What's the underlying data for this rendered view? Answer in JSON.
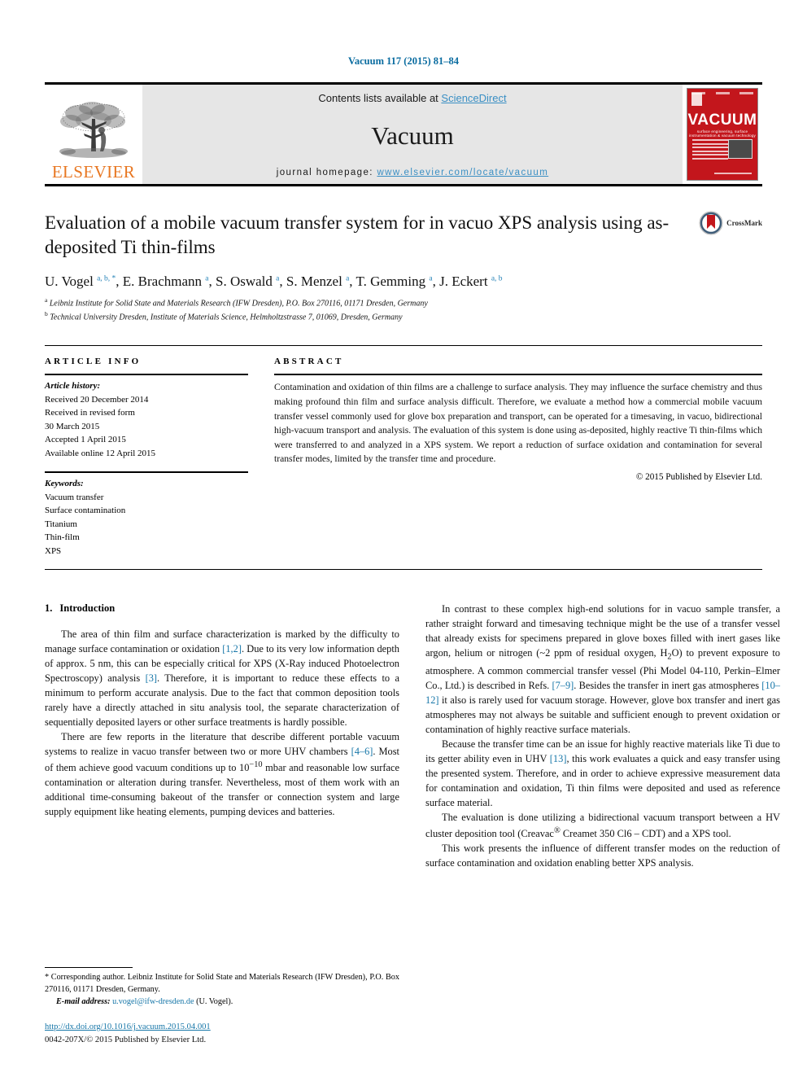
{
  "running_head": "Vacuum 117 (2015) 81–84",
  "masthead": {
    "publisher_name": "ELSEVIER",
    "contents_prefix": "Contents lists available at ",
    "contents_link": "ScienceDirect",
    "journal_name": "Vacuum",
    "homepage_prefix": "journal homepage: ",
    "homepage_url": "www.elsevier.com/locate/vacuum",
    "cover": {
      "title": "VACUUM",
      "subtitle": "surface engineering, surface instrumentation & vacuum technology"
    }
  },
  "article": {
    "title": "Evaluation of a mobile vacuum transfer system for in vacuo XPS analysis using as-deposited Ti thin-films",
    "crossmark_label": "CrossMark",
    "authors_html": "U. Vogel <sup>a, b, *</sup>, E. Brachmann <sup>a</sup>, S. Oswald <sup>a</sup>, S. Menzel <sup>a</sup>, T. Gemming <sup>a</sup>, J. Eckert <sup>a, b</sup>",
    "affiliations": [
      "Leibniz Institute for Solid State and Materials Research (IFW Dresden), P.O. Box 270116, 01171 Dresden, Germany",
      "Technical University Dresden, Institute of Materials Science, Helmholtzstrasse 7, 01069, Dresden, Germany"
    ]
  },
  "article_info": {
    "label": "ARTICLE INFO",
    "history_title": "Article history:",
    "history": [
      "Received 20 December 2014",
      "Received in revised form",
      "30 March 2015",
      "Accepted 1 April 2015",
      "Available online 12 April 2015"
    ],
    "keywords_title": "Keywords:",
    "keywords": [
      "Vacuum transfer",
      "Surface contamination",
      "Titanium",
      "Thin-film",
      "XPS"
    ]
  },
  "abstract": {
    "label": "ABSTRACT",
    "text": "Contamination and oxidation of thin films are a challenge to surface analysis. They may influence the surface chemistry and thus making profound thin film and surface analysis difficult. Therefore, we evaluate a method how a commercial mobile vacuum transfer vessel commonly used for glove box preparation and transport, can be operated for a timesaving, in vacuo, bidirectional high-vacuum transport and analysis. The evaluation of this system is done using as-deposited, highly reactive Ti thin-films which were transferred to and analyzed in a XPS system. We report a reduction of surface oxidation and contamination for several transfer modes, limited by the transfer time and procedure.",
    "copyright": "© 2015 Published by Elsevier Ltd."
  },
  "body": {
    "section1_number": "1.",
    "section1_title": "Introduction",
    "left_paragraphs_html": [
      "The area of thin film and surface characterization is marked by the difficulty to manage surface contamination or oxidation <span class=\"ref\">[1,2]</span>. Due to its very low information depth of approx. 5 nm, this can be especially critical for XPS (X-Ray induced Photoelectron Spectroscopy) analysis <span class=\"ref\">[3]</span>. Therefore, it is important to reduce these effects to a minimum to perform accurate analysis. Due to the fact that common deposition tools rarely have a directly attached in situ analysis tool, the separate characterization of sequentially deposited layers or other surface treatments is hardly possible.",
      "There are few reports in the literature that describe different portable vacuum systems to realize in vacuo transfer between two or more UHV chambers <span class=\"ref\">[4–6]</span>. Most of them achieve good vacuum conditions up to 10<sup>−10</sup> mbar and reasonable low surface contamination or alteration during transfer. Nevertheless, most of them work with an additional time-consuming bakeout of the transfer or connection system and large supply equipment like heating elements, pumping devices and batteries."
    ],
    "right_paragraphs_html": [
      "In contrast to these complex high-end solutions for in vacuo sample transfer, a rather straight forward and timesaving technique might be the use of a transfer vessel that already exists for specimens prepared in glove boxes filled with inert gases like argon, helium or nitrogen (~2 ppm of residual oxygen, H<sub>2</sub>O) to prevent exposure to atmosphere. A common commercial transfer vessel (Phi Model 04-110, Perkin–Elmer Co., Ltd.) is described in Refs. <span class=\"ref\">[7–9]</span>. Besides the transfer in inert gas atmospheres <span class=\"ref\">[10–12]</span> it also is rarely used for vacuum storage. However, glove box transfer and inert gas atmospheres may not always be suitable and sufficient enough to prevent oxidation or contamination of highly reactive surface materials.",
      "Because the transfer time can be an issue for highly reactive materials like Ti due to its getter ability even in UHV <span class=\"ref\">[13]</span>, this work evaluates a quick and easy transfer using the presented system. Therefore, and in order to achieve expressive measurement data for contamination and oxidation, Ti thin films were deposited and used as reference surface material.",
      "The evaluation is done utilizing a bidirectional vacuum transport between a HV cluster deposition tool (Creavac<sup>®</sup> Creamet 350 Cl6 – CDT) and a XPS tool.",
      "This work presents the influence of different transfer modes on the reduction of surface contamination and oxidation enabling better XPS analysis."
    ]
  },
  "footnote": {
    "corresponding_html": "* Corresponding author. Leibniz Institute for Solid State and Materials Research (IFW Dresden), P.O. Box 270116, 01171 Dresden, Germany.",
    "email_label": "E-mail address:",
    "email": "u.vogel@ifw-dresden.de",
    "email_suffix": "(U. Vogel).",
    "doi": "http://dx.doi.org/10.1016/j.vacuum.2015.04.001",
    "issn": "0042-207X/© 2015 Published by Elsevier Ltd."
  },
  "colors": {
    "link_blue": "#1676a8",
    "elsevier_orange": "#E87722",
    "cover_red": "#C3161C",
    "masthead_gray": "#e6e6e6"
  }
}
